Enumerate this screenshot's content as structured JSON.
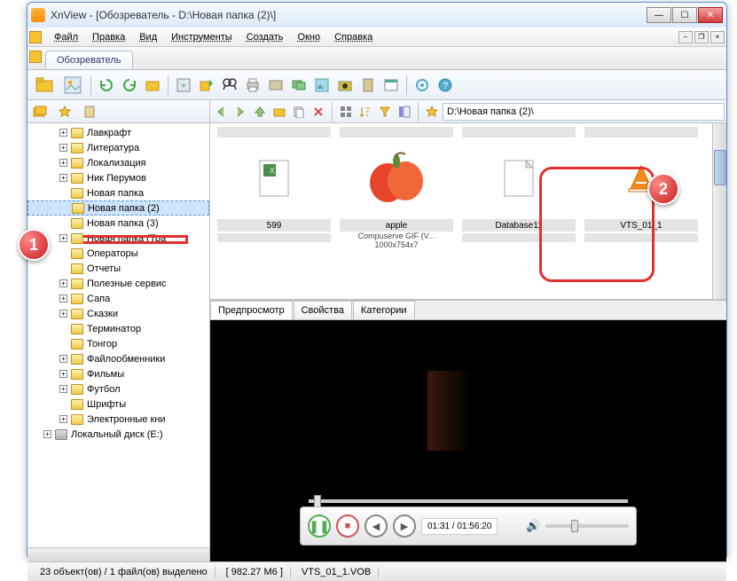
{
  "title": "XnView - [Обозреватель - D:\\Новая папка (2)\\]",
  "menu": {
    "file": "Файл",
    "edit": "Правка",
    "view": "Вид",
    "tools": "Инструменты",
    "create": "Создать",
    "window": "Окно",
    "help": "Справка"
  },
  "tab": {
    "browser": "Обозреватель"
  },
  "path": "D:\\Новая папка (2)\\",
  "tree": [
    {
      "label": "Лавкрафт",
      "type": "folder",
      "expandable": true
    },
    {
      "label": "Литература",
      "type": "folder",
      "expandable": true
    },
    {
      "label": "Локализация",
      "type": "folder",
      "expandable": true
    },
    {
      "label": "Ник Перумов",
      "type": "folder",
      "expandable": true
    },
    {
      "label": "Новая папка",
      "type": "folder",
      "expandable": false
    },
    {
      "label": "Новая папка (2)",
      "type": "folder",
      "expandable": false,
      "selected": true
    },
    {
      "label": "Новая папка (3)",
      "type": "folder",
      "expandable": false
    },
    {
      "label": "Новая папка (Тра",
      "type": "folder",
      "expandable": true
    },
    {
      "label": "Операторы",
      "type": "folder",
      "expandable": false
    },
    {
      "label": "Отчеты",
      "type": "folder",
      "expandable": false
    },
    {
      "label": "Полезные сервис",
      "type": "folder",
      "expandable": true
    },
    {
      "label": "Сапа",
      "type": "folder",
      "expandable": true
    },
    {
      "label": "Сказки",
      "type": "folder",
      "expandable": true
    },
    {
      "label": "Терминатор",
      "type": "folder",
      "expandable": false
    },
    {
      "label": "Тонгор",
      "type": "folder",
      "expandable": false
    },
    {
      "label": "Файлообменники",
      "type": "folder",
      "expandable": true
    },
    {
      "label": "Фильмы",
      "type": "folder",
      "expandable": true
    },
    {
      "label": "Футбол",
      "type": "folder",
      "expandable": true
    },
    {
      "label": "Шрифты",
      "type": "folder",
      "expandable": false
    },
    {
      "label": "Электронные кни",
      "type": "folder",
      "expandable": true
    },
    {
      "label": "Локальный диск (E:)",
      "type": "disk",
      "expandable": true
    }
  ],
  "thumbs": [
    {
      "name": "599",
      "sub1": "",
      "sub2": ""
    },
    {
      "name": "apple",
      "sub1": "Compuserve GIF (V...",
      "sub2": "1000x754x7"
    },
    {
      "name": "Database11",
      "sub1": "",
      "sub2": ""
    },
    {
      "name": "VTS_01_1",
      "sub1": "",
      "sub2": ""
    }
  ],
  "preview_tabs": {
    "preview": "Предпросмотр",
    "properties": "Свойства",
    "categories": "Категории"
  },
  "player": {
    "time": "01:31 / 01:56:20"
  },
  "status": {
    "objects": "23 объект(ов) / 1 файл(ов) выделено",
    "size": "[ 982.27 M6 ]",
    "filename": "VTS_01_1.VOB"
  },
  "callouts": {
    "one": "1",
    "two": "2"
  }
}
